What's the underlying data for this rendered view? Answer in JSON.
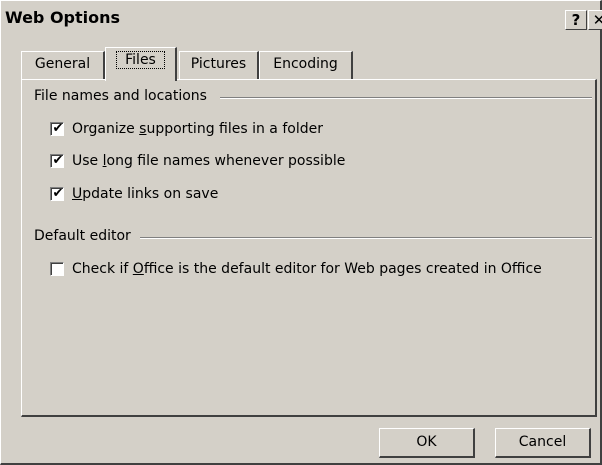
{
  "window": {
    "title": "Web Options",
    "help_glyph": "?",
    "close_glyph": "✕"
  },
  "tabs": [
    {
      "label": "General",
      "active": false
    },
    {
      "label": "Files",
      "active": true
    },
    {
      "label": "Pictures",
      "active": false
    },
    {
      "label": "Encoding",
      "active": false
    }
  ],
  "files_tab": {
    "group1": {
      "label": "File names and locations",
      "options": [
        {
          "pre": "Organize ",
          "accel": "s",
          "post": "upporting files in a folder",
          "checked": true
        },
        {
          "pre": "Use ",
          "accel": "l",
          "post": "ong file names whenever possible",
          "checked": true
        },
        {
          "pre": "",
          "accel": "U",
          "post": "pdate links on save",
          "checked": true
        }
      ]
    },
    "group2": {
      "label": "Default editor",
      "options": [
        {
          "pre": "Check if ",
          "accel": "O",
          "post": "ffice is the default editor for Web pages created in Office",
          "checked": false
        }
      ]
    }
  },
  "buttons": {
    "ok": "OK",
    "cancel": "Cancel"
  },
  "check_mark": "✔"
}
